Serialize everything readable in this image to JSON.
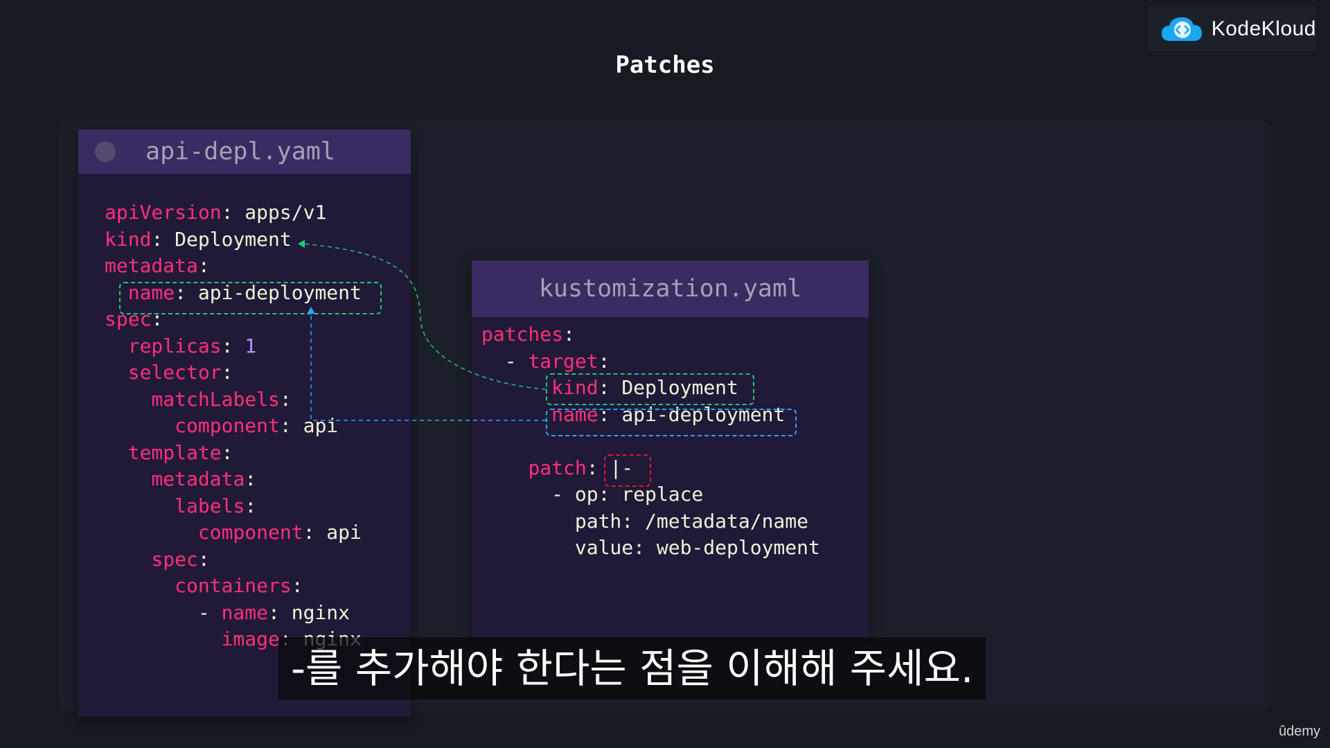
{
  "slide": {
    "title": "Patches",
    "brand": {
      "name": "KodeKloud",
      "icon": "kodekloud-cloud-logo-icon"
    },
    "subtitle": "-를 추가해야 한다는 점을 이해해 주세요.",
    "watermark": "ûdemy"
  },
  "files": [
    {
      "name": "api-depl.yaml",
      "lines": [
        [
          {
            "t": "k",
            "s": "apiVersion"
          },
          {
            "t": "p",
            "s": ": "
          },
          {
            "t": "v",
            "s": "apps/v1"
          }
        ],
        [
          {
            "t": "k",
            "s": "kind"
          },
          {
            "t": "p",
            "s": ": "
          },
          {
            "t": "v",
            "s": "Deployment"
          }
        ],
        [
          {
            "t": "k",
            "s": "metadata"
          },
          {
            "t": "p",
            "s": ":"
          }
        ],
        [
          {
            "t": "p",
            "s": "  "
          },
          {
            "t": "k",
            "s": "name"
          },
          {
            "t": "p",
            "s": ": "
          },
          {
            "t": "v",
            "s": "api-deployment"
          }
        ],
        [
          {
            "t": "k",
            "s": "spec"
          },
          {
            "t": "p",
            "s": ":"
          }
        ],
        [
          {
            "t": "p",
            "s": "  "
          },
          {
            "t": "k",
            "s": "replicas"
          },
          {
            "t": "p",
            "s": ": "
          },
          {
            "t": "n",
            "s": "1"
          }
        ],
        [
          {
            "t": "p",
            "s": "  "
          },
          {
            "t": "k",
            "s": "selector"
          },
          {
            "t": "p",
            "s": ":"
          }
        ],
        [
          {
            "t": "p",
            "s": "    "
          },
          {
            "t": "k",
            "s": "matchLabels"
          },
          {
            "t": "p",
            "s": ":"
          }
        ],
        [
          {
            "t": "p",
            "s": "      "
          },
          {
            "t": "k",
            "s": "component"
          },
          {
            "t": "p",
            "s": ": "
          },
          {
            "t": "v",
            "s": "api"
          }
        ],
        [
          {
            "t": "p",
            "s": "  "
          },
          {
            "t": "k",
            "s": "template"
          },
          {
            "t": "p",
            "s": ":"
          }
        ],
        [
          {
            "t": "p",
            "s": "    "
          },
          {
            "t": "k",
            "s": "metadata"
          },
          {
            "t": "p",
            "s": ":"
          }
        ],
        [
          {
            "t": "p",
            "s": "      "
          },
          {
            "t": "k",
            "s": "labels"
          },
          {
            "t": "p",
            "s": ":"
          }
        ],
        [
          {
            "t": "p",
            "s": "        "
          },
          {
            "t": "k",
            "s": "component"
          },
          {
            "t": "p",
            "s": ": "
          },
          {
            "t": "v",
            "s": "api"
          }
        ],
        [
          {
            "t": "p",
            "s": "    "
          },
          {
            "t": "k",
            "s": "spec"
          },
          {
            "t": "p",
            "s": ":"
          }
        ],
        [
          {
            "t": "p",
            "s": "      "
          },
          {
            "t": "k",
            "s": "containers"
          },
          {
            "t": "p",
            "s": ":"
          }
        ],
        [
          {
            "t": "p",
            "s": "        - "
          },
          {
            "t": "k",
            "s": "name"
          },
          {
            "t": "p",
            "s": ": "
          },
          {
            "t": "v",
            "s": "nginx"
          }
        ],
        [
          {
            "t": "p",
            "s": "          "
          },
          {
            "t": "k",
            "s": "image"
          },
          {
            "t": "p",
            "s": ": "
          },
          {
            "t": "v",
            "s": "nginx"
          }
        ]
      ]
    },
    {
      "name": "kustomization.yaml",
      "lines": [
        [
          {
            "t": "k",
            "s": "patches"
          },
          {
            "t": "p",
            "s": ":"
          }
        ],
        [
          {
            "t": "p",
            "s": "  - "
          },
          {
            "t": "k",
            "s": "target"
          },
          {
            "t": "p",
            "s": ":"
          }
        ],
        [
          {
            "t": "p",
            "s": "      "
          },
          {
            "t": "k",
            "s": "kind"
          },
          {
            "t": "p",
            "s": ": "
          },
          {
            "t": "v",
            "s": "Deployment"
          }
        ],
        [
          {
            "t": "p",
            "s": "      "
          },
          {
            "t": "k",
            "s": "name"
          },
          {
            "t": "p",
            "s": ": "
          },
          {
            "t": "v",
            "s": "api-deployment"
          }
        ],
        [],
        [
          {
            "t": "p",
            "s": "    "
          },
          {
            "t": "k",
            "s": "patch"
          },
          {
            "t": "p",
            "s": ": "
          },
          {
            "t": "v",
            "s": "|-"
          }
        ],
        [
          {
            "t": "p",
            "s": "      - "
          },
          {
            "t": "v",
            "s": "op: replace"
          }
        ],
        [
          {
            "t": "p",
            "s": "        "
          },
          {
            "t": "v",
            "s": "path: /metadata/name"
          }
        ],
        [
          {
            "t": "p",
            "s": "        "
          },
          {
            "t": "v",
            "s": "value: web-deployment"
          }
        ]
      ]
    }
  ],
  "colors": {
    "yaml_key": "#ff2f7e",
    "yaml_value": "#f2f2d8",
    "yaml_number": "#b992ff",
    "highlight_kind": "#22c77a",
    "highlight_name": "#2ba3ff",
    "highlight_patch_op": "#e0182c"
  }
}
